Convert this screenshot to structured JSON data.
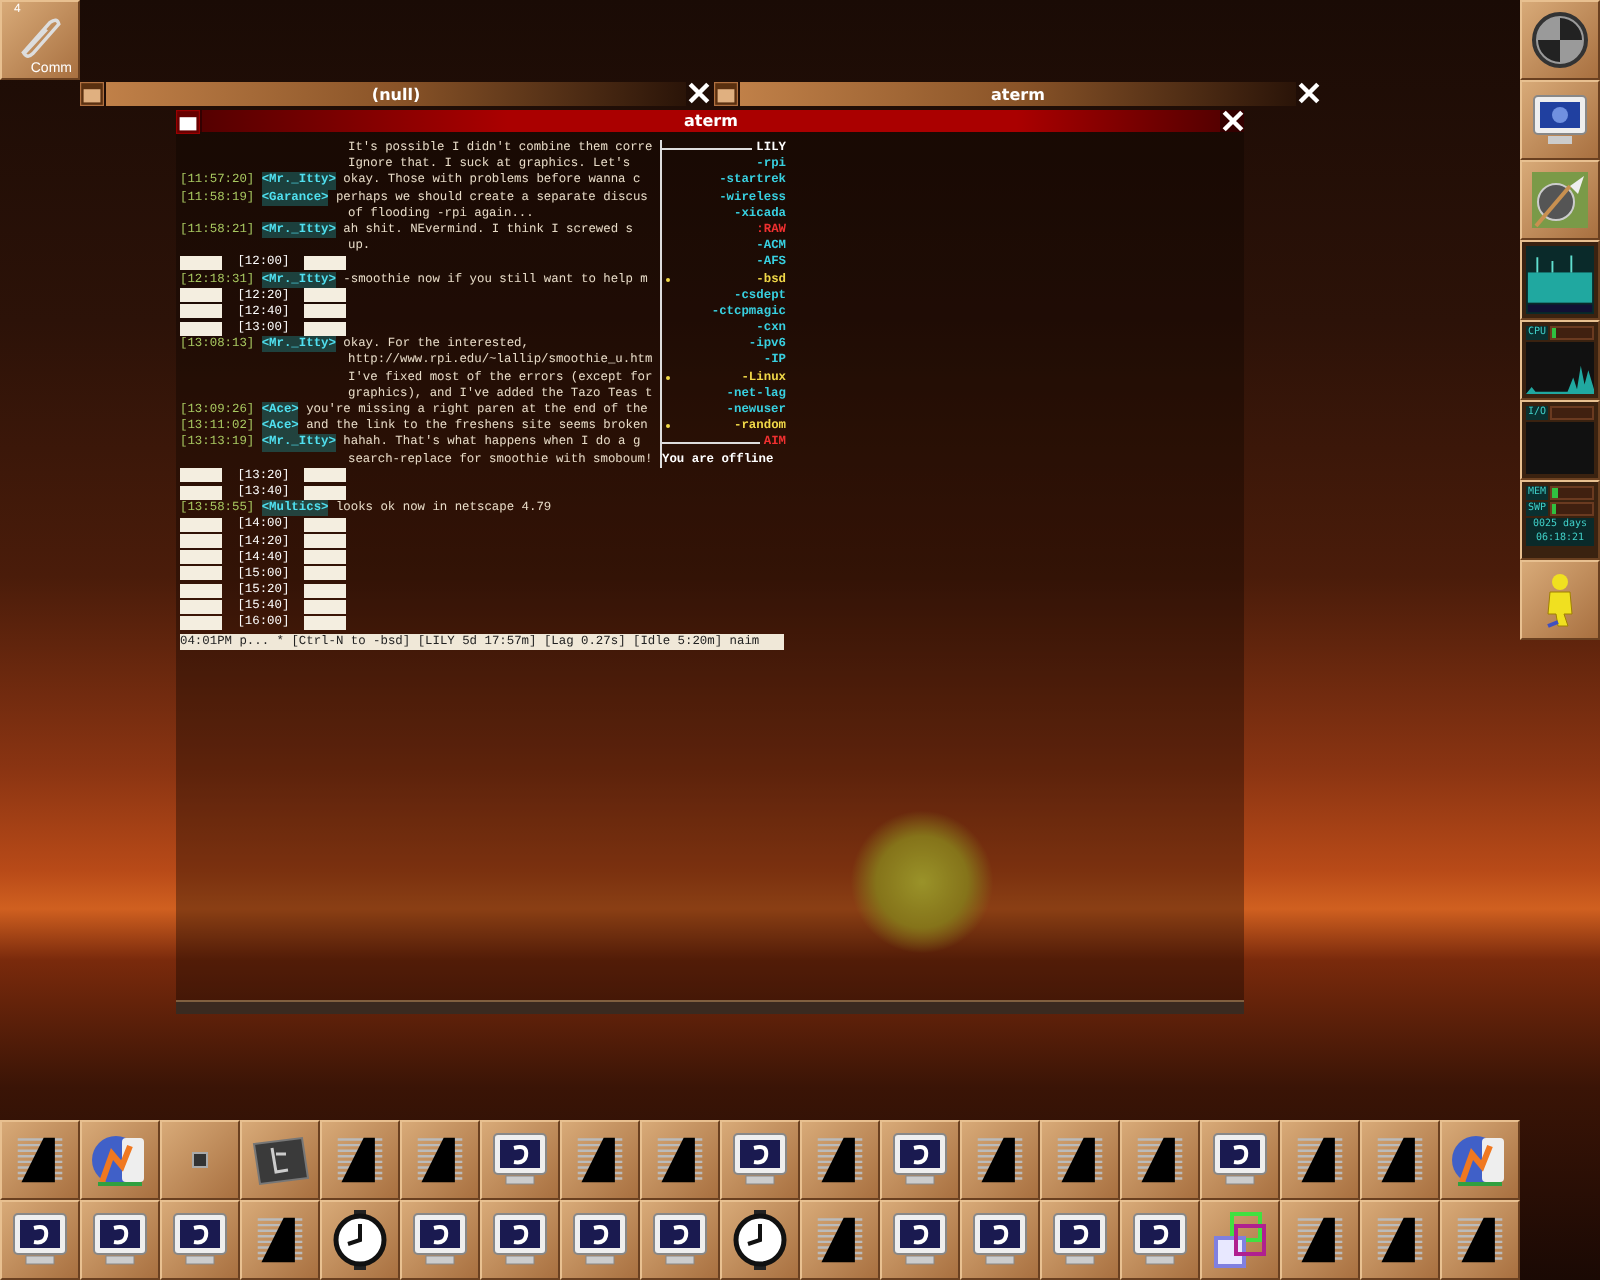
{
  "launcher": {
    "number": "4",
    "label": "Comm"
  },
  "title_bars": [
    {
      "title": "(null)"
    },
    {
      "title": "aterm"
    }
  ],
  "terminal": {
    "title": "aterm",
    "lines": [
      {
        "kind": "cont",
        "text": "It's possible I didn't combine them corre"
      },
      {
        "kind": "cont",
        "text": "Ignore that.  I suck at graphics.  Let's"
      },
      {
        "kind": "msg",
        "time": "[11:57:20]",
        "nick": "<Mr._Itty>",
        "text": "okay.  Those with problems before wanna c"
      },
      {
        "kind": "msg",
        "time": "[11:58:19]",
        "nick": "<Garance>",
        "text": "perhaps we should create a separate discus"
      },
      {
        "kind": "cont",
        "text": "of flooding -rpi again..."
      },
      {
        "kind": "msg",
        "time": "[11:58:21]",
        "nick": "<Mr._Itty>",
        "text": "ah shit.  NEvermind.  I think I screwed s"
      },
      {
        "kind": "cont",
        "text": "up."
      },
      {
        "kind": "clock",
        "time": "[12:00]"
      },
      {
        "kind": "msg",
        "time": "[12:18:31]",
        "nick": "<Mr._Itty>",
        "text": "-smoothie now if you still want to help m"
      },
      {
        "kind": "clock",
        "time": "[12:20]"
      },
      {
        "kind": "clock",
        "time": "[12:40]"
      },
      {
        "kind": "clock",
        "time": "[13:00]"
      },
      {
        "kind": "msg",
        "time": "[13:08:13]",
        "nick": "<Mr._Itty>",
        "text": "okay.  For the interested,"
      },
      {
        "kind": "cont",
        "text": "http://www.rpi.edu/~lallip/smoothie_u.htm"
      },
      {
        "kind": "cont",
        "text": "I've fixed most of the errors (except for"
      },
      {
        "kind": "cont",
        "text": "graphics), and I've added the Tazo Teas t"
      },
      {
        "kind": "msg",
        "time": "[13:09:26]",
        "nick": "<Ace>",
        "text": "you're missing a right paren at the end of the"
      },
      {
        "kind": "msg",
        "time": "[13:11:02]",
        "nick": "<Ace>",
        "text": "and the link to the freshens site seems broken"
      },
      {
        "kind": "msg",
        "time": "[13:13:19]",
        "nick": "<Mr._Itty>",
        "text": "hahah.  That's what happens when I do a g"
      },
      {
        "kind": "cont",
        "text": "search-replace for smoothie with smoboum!"
      },
      {
        "kind": "clock",
        "time": "[13:20]"
      },
      {
        "kind": "clock",
        "time": "[13:40]"
      },
      {
        "kind": "msg",
        "time": "[13:58:55]",
        "nick": "<Multics>",
        "text": "looks ok now in netscape 4.79"
      },
      {
        "kind": "clock",
        "time": "[14:00]"
      },
      {
        "kind": "clock",
        "time": "[14:20]"
      },
      {
        "kind": "clock",
        "time": "[14:40]"
      },
      {
        "kind": "clock",
        "time": "[15:00]"
      },
      {
        "kind": "clock",
        "time": "[15:20]"
      },
      {
        "kind": "clock",
        "time": "[15:40]"
      },
      {
        "kind": "clock",
        "time": "[16:00]"
      }
    ],
    "channels": [
      {
        "kind": "header",
        "name": "LILY",
        "color": "#ffffff",
        "marked": false
      },
      {
        "kind": "channel",
        "name": "-rpi",
        "color": "#38d0e0",
        "marked": false
      },
      {
        "kind": "channel",
        "name": "-startrek",
        "color": "#38d0e0",
        "marked": false
      },
      {
        "kind": "channel",
        "name": "-wireless",
        "color": "#38d0e0",
        "marked": false
      },
      {
        "kind": "channel",
        "name": "-xicada",
        "color": "#38d0e0",
        "marked": false
      },
      {
        "kind": "channel",
        "name": ":RAW",
        "color": "#f03030",
        "marked": false
      },
      {
        "kind": "channel",
        "name": "-ACM",
        "color": "#38d0e0",
        "marked": false
      },
      {
        "kind": "channel",
        "name": "-AFS",
        "color": "#38d0e0",
        "marked": false
      },
      {
        "kind": "channel",
        "name": "-bsd",
        "color": "#f0d848",
        "marked": true
      },
      {
        "kind": "channel",
        "name": "-csdept",
        "color": "#38d0e0",
        "marked": false
      },
      {
        "kind": "channel",
        "name": "-ctcpmagic",
        "color": "#38d0e0",
        "marked": false
      },
      {
        "kind": "channel",
        "name": "-cxn",
        "color": "#38d0e0",
        "marked": false
      },
      {
        "kind": "channel",
        "name": "-ipv6",
        "color": "#38d0e0",
        "marked": false
      },
      {
        "kind": "channel",
        "name": "-IP",
        "color": "#38d0e0",
        "marked": false
      },
      {
        "kind": "channel",
        "name": "-Linux",
        "color": "#f0d848",
        "marked": true
      },
      {
        "kind": "channel",
        "name": "-net-lag",
        "color": "#38d0e0",
        "marked": false
      },
      {
        "kind": "channel",
        "name": "-newuser",
        "color": "#38d0e0",
        "marked": false
      },
      {
        "kind": "channel",
        "name": "-random",
        "color": "#f0d848",
        "marked": true
      },
      {
        "kind": "header",
        "name": "AIM",
        "color": "#f03030",
        "marked": false
      },
      {
        "kind": "offline",
        "name": "You are offline",
        "color": "#ffffff",
        "marked": false
      }
    ],
    "status": "04:01PM p... * [Ctrl-N to -bsd] [LILY 5d 17:57m] [Lag 0.27s] [Idle 5:20m] naim"
  },
  "right_dock": [
    {
      "kind": "disk"
    },
    {
      "kind": "monitor"
    },
    {
      "kind": "paint"
    },
    {
      "kind": "net"
    },
    {
      "kind": "cpu",
      "label": "CPU",
      "level": 0.12
    },
    {
      "kind": "io",
      "label": "I/O"
    },
    {
      "kind": "mem",
      "meters": [
        {
          "label": "MEM",
          "level": 0.15
        },
        {
          "label": "SWP",
          "level": 0.12
        }
      ],
      "uptime": "0025 days",
      "clock": "06:18:21"
    },
    {
      "kind": "person"
    }
  ],
  "bottom_dock": [
    [
      {
        "kind": "term"
      },
      {
        "kind": "logo"
      },
      {
        "kind": "small"
      },
      {
        "kind": "tablet"
      },
      {
        "kind": "term"
      },
      {
        "kind": "term"
      },
      {
        "kind": "monitor"
      },
      {
        "kind": "term"
      },
      {
        "kind": "term"
      },
      {
        "kind": "monitor"
      },
      {
        "kind": "term"
      },
      {
        "kind": "monitor"
      },
      {
        "kind": "term"
      },
      {
        "kind": "term"
      },
      {
        "kind": "term"
      },
      {
        "kind": "monitor"
      },
      {
        "kind": "term"
      },
      {
        "kind": "term"
      },
      {
        "kind": "logo"
      }
    ],
    [
      {
        "kind": "monitor"
      },
      {
        "kind": "monitor"
      },
      {
        "kind": "monitor"
      },
      {
        "kind": "term"
      },
      {
        "kind": "clock"
      },
      {
        "kind": "monitor"
      },
      {
        "kind": "monitor"
      },
      {
        "kind": "monitor"
      },
      {
        "kind": "monitor"
      },
      {
        "kind": "clock"
      },
      {
        "kind": "term"
      },
      {
        "kind": "monitor"
      },
      {
        "kind": "monitor"
      },
      {
        "kind": "monitor"
      },
      {
        "kind": "monitor"
      },
      {
        "kind": "windows"
      },
      {
        "kind": "term"
      },
      {
        "kind": "term"
      },
      {
        "kind": "term"
      }
    ]
  ]
}
